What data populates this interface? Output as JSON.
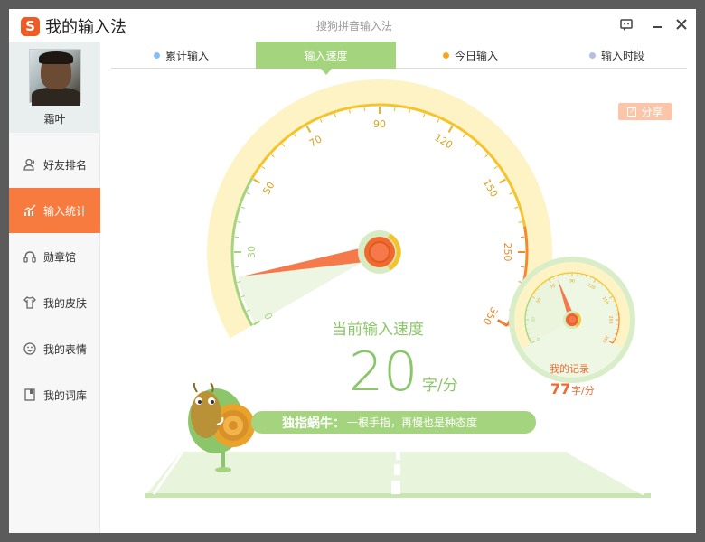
{
  "window": {
    "title": "我的输入法",
    "subtitle": "搜狗拼音输入法",
    "logo_text": "S"
  },
  "user": {
    "name": "霜叶"
  },
  "sidebar": {
    "items": [
      {
        "label": "好友排名",
        "icon": "friends-icon",
        "active": false
      },
      {
        "label": "输入统计",
        "icon": "chart-icon",
        "active": true
      },
      {
        "label": "勋章馆",
        "icon": "medal-icon",
        "active": false
      },
      {
        "label": "我的皮肤",
        "icon": "shirt-icon",
        "active": false
      },
      {
        "label": "我的表情",
        "icon": "smiley-icon",
        "active": false
      },
      {
        "label": "我的词库",
        "icon": "book-icon",
        "active": false
      }
    ]
  },
  "tabs": [
    {
      "label": "累计输入",
      "dot_color": "#88bdf0",
      "active": false
    },
    {
      "label": "输入速度",
      "dot_color": "",
      "active": true
    },
    {
      "label": "今日输入",
      "dot_color": "#f5a623",
      "active": false
    },
    {
      "label": "输入时段",
      "dot_color": "#b4bce8",
      "active": false
    }
  ],
  "share_label": "分享",
  "speed": {
    "label": "当前输入速度",
    "value": "20",
    "unit": "字/分",
    "gauge_ticks": [
      "0",
      "30",
      "50",
      "70",
      "90",
      "120",
      "150",
      "250",
      "350"
    ],
    "gauge_values": [
      0,
      30,
      50,
      70,
      90,
      120,
      150,
      250,
      350
    ],
    "current": 20
  },
  "record": {
    "label": "我的记录",
    "value": "77",
    "unit": "字/分",
    "gauge_ticks": [
      "0",
      "30",
      "50",
      "70",
      "90",
      "120",
      "150",
      "250",
      "350"
    ],
    "current": 77
  },
  "banner": {
    "title": "独指蜗牛：",
    "text": "一根手指，再慢也是种态度"
  },
  "colors": {
    "accent": "#f77b3f",
    "green": "#a5d47e",
    "orange": "#f5a623",
    "needle": "#f06a2f"
  }
}
